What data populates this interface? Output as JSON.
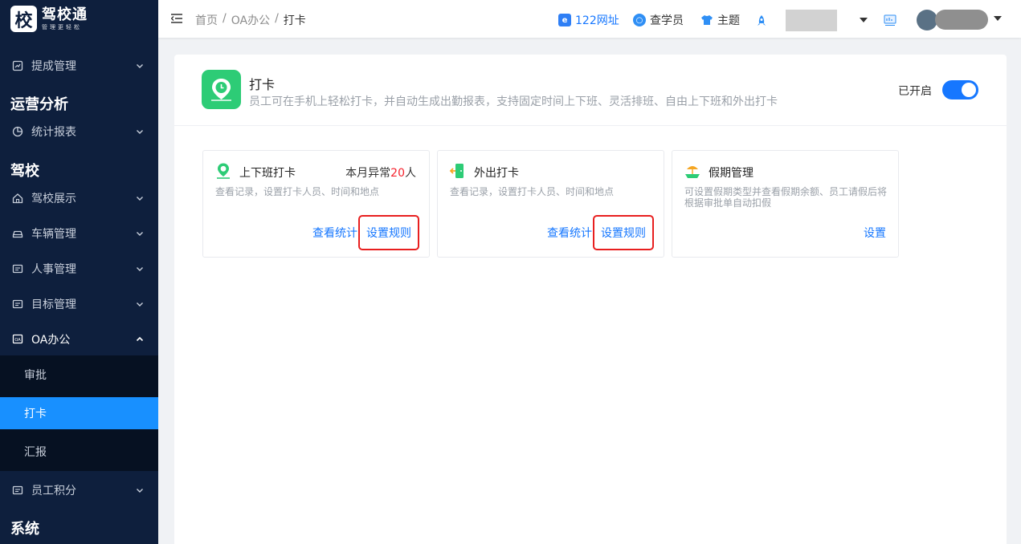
{
  "logo": {
    "mark": "校",
    "title": "驾校通",
    "subtitle": "管理更轻松"
  },
  "sidebar": {
    "items": [
      {
        "label": "提成管理",
        "icon": "report-icon"
      },
      {
        "group": "运营分析"
      },
      {
        "label": "统计报表",
        "icon": "pie-chart-icon"
      },
      {
        "group": "驾校"
      },
      {
        "label": "驾校展示",
        "icon": "home-icon"
      },
      {
        "label": "车辆管理",
        "icon": "car-icon"
      },
      {
        "label": "人事管理",
        "icon": "id-card-icon"
      },
      {
        "label": "目标管理",
        "icon": "target-icon"
      },
      {
        "label": "OA办公",
        "icon": "oa-icon"
      },
      {
        "label": "员工积分",
        "icon": "points-icon"
      },
      {
        "group": "系统"
      }
    ],
    "oa_sub": [
      "审批",
      "打卡",
      "汇报"
    ],
    "active_sub": "打卡"
  },
  "header": {
    "breadcrumb": [
      "首页",
      "OA办公",
      "打卡"
    ],
    "links": {
      "site": "122网址",
      "lookup": "查学员",
      "theme": "主题"
    }
  },
  "app": {
    "title": "打卡",
    "description": "员工可在手机上轻松打卡，并自动生成出勤报表，支持固定时间上下班、灵活排班、自由上下班和外出打卡",
    "status_label": "已开启",
    "enabled": true
  },
  "features": [
    {
      "title": "上下班打卡",
      "stat_prefix": "本月异常",
      "stat_number": "20",
      "stat_suffix": "人",
      "description": "查看记录，设置打卡人员、时间和地点",
      "link1": "查看统计",
      "link2": "设置规则"
    },
    {
      "title": "外出打卡",
      "description": "查看记录，设置打卡人员、时间和地点",
      "link1": "查看统计",
      "link2": "设置规则"
    },
    {
      "title": "假期管理",
      "description": "可设置假期类型并查看假期余额、员工请假后将根据审批单自动扣假",
      "link1": "设置"
    }
  ],
  "colors": {
    "sidebar_bg": "#0e1f3d",
    "accent": "#1677ff",
    "app_icon": "#2dcc76",
    "highlight": "#e81f1f"
  }
}
